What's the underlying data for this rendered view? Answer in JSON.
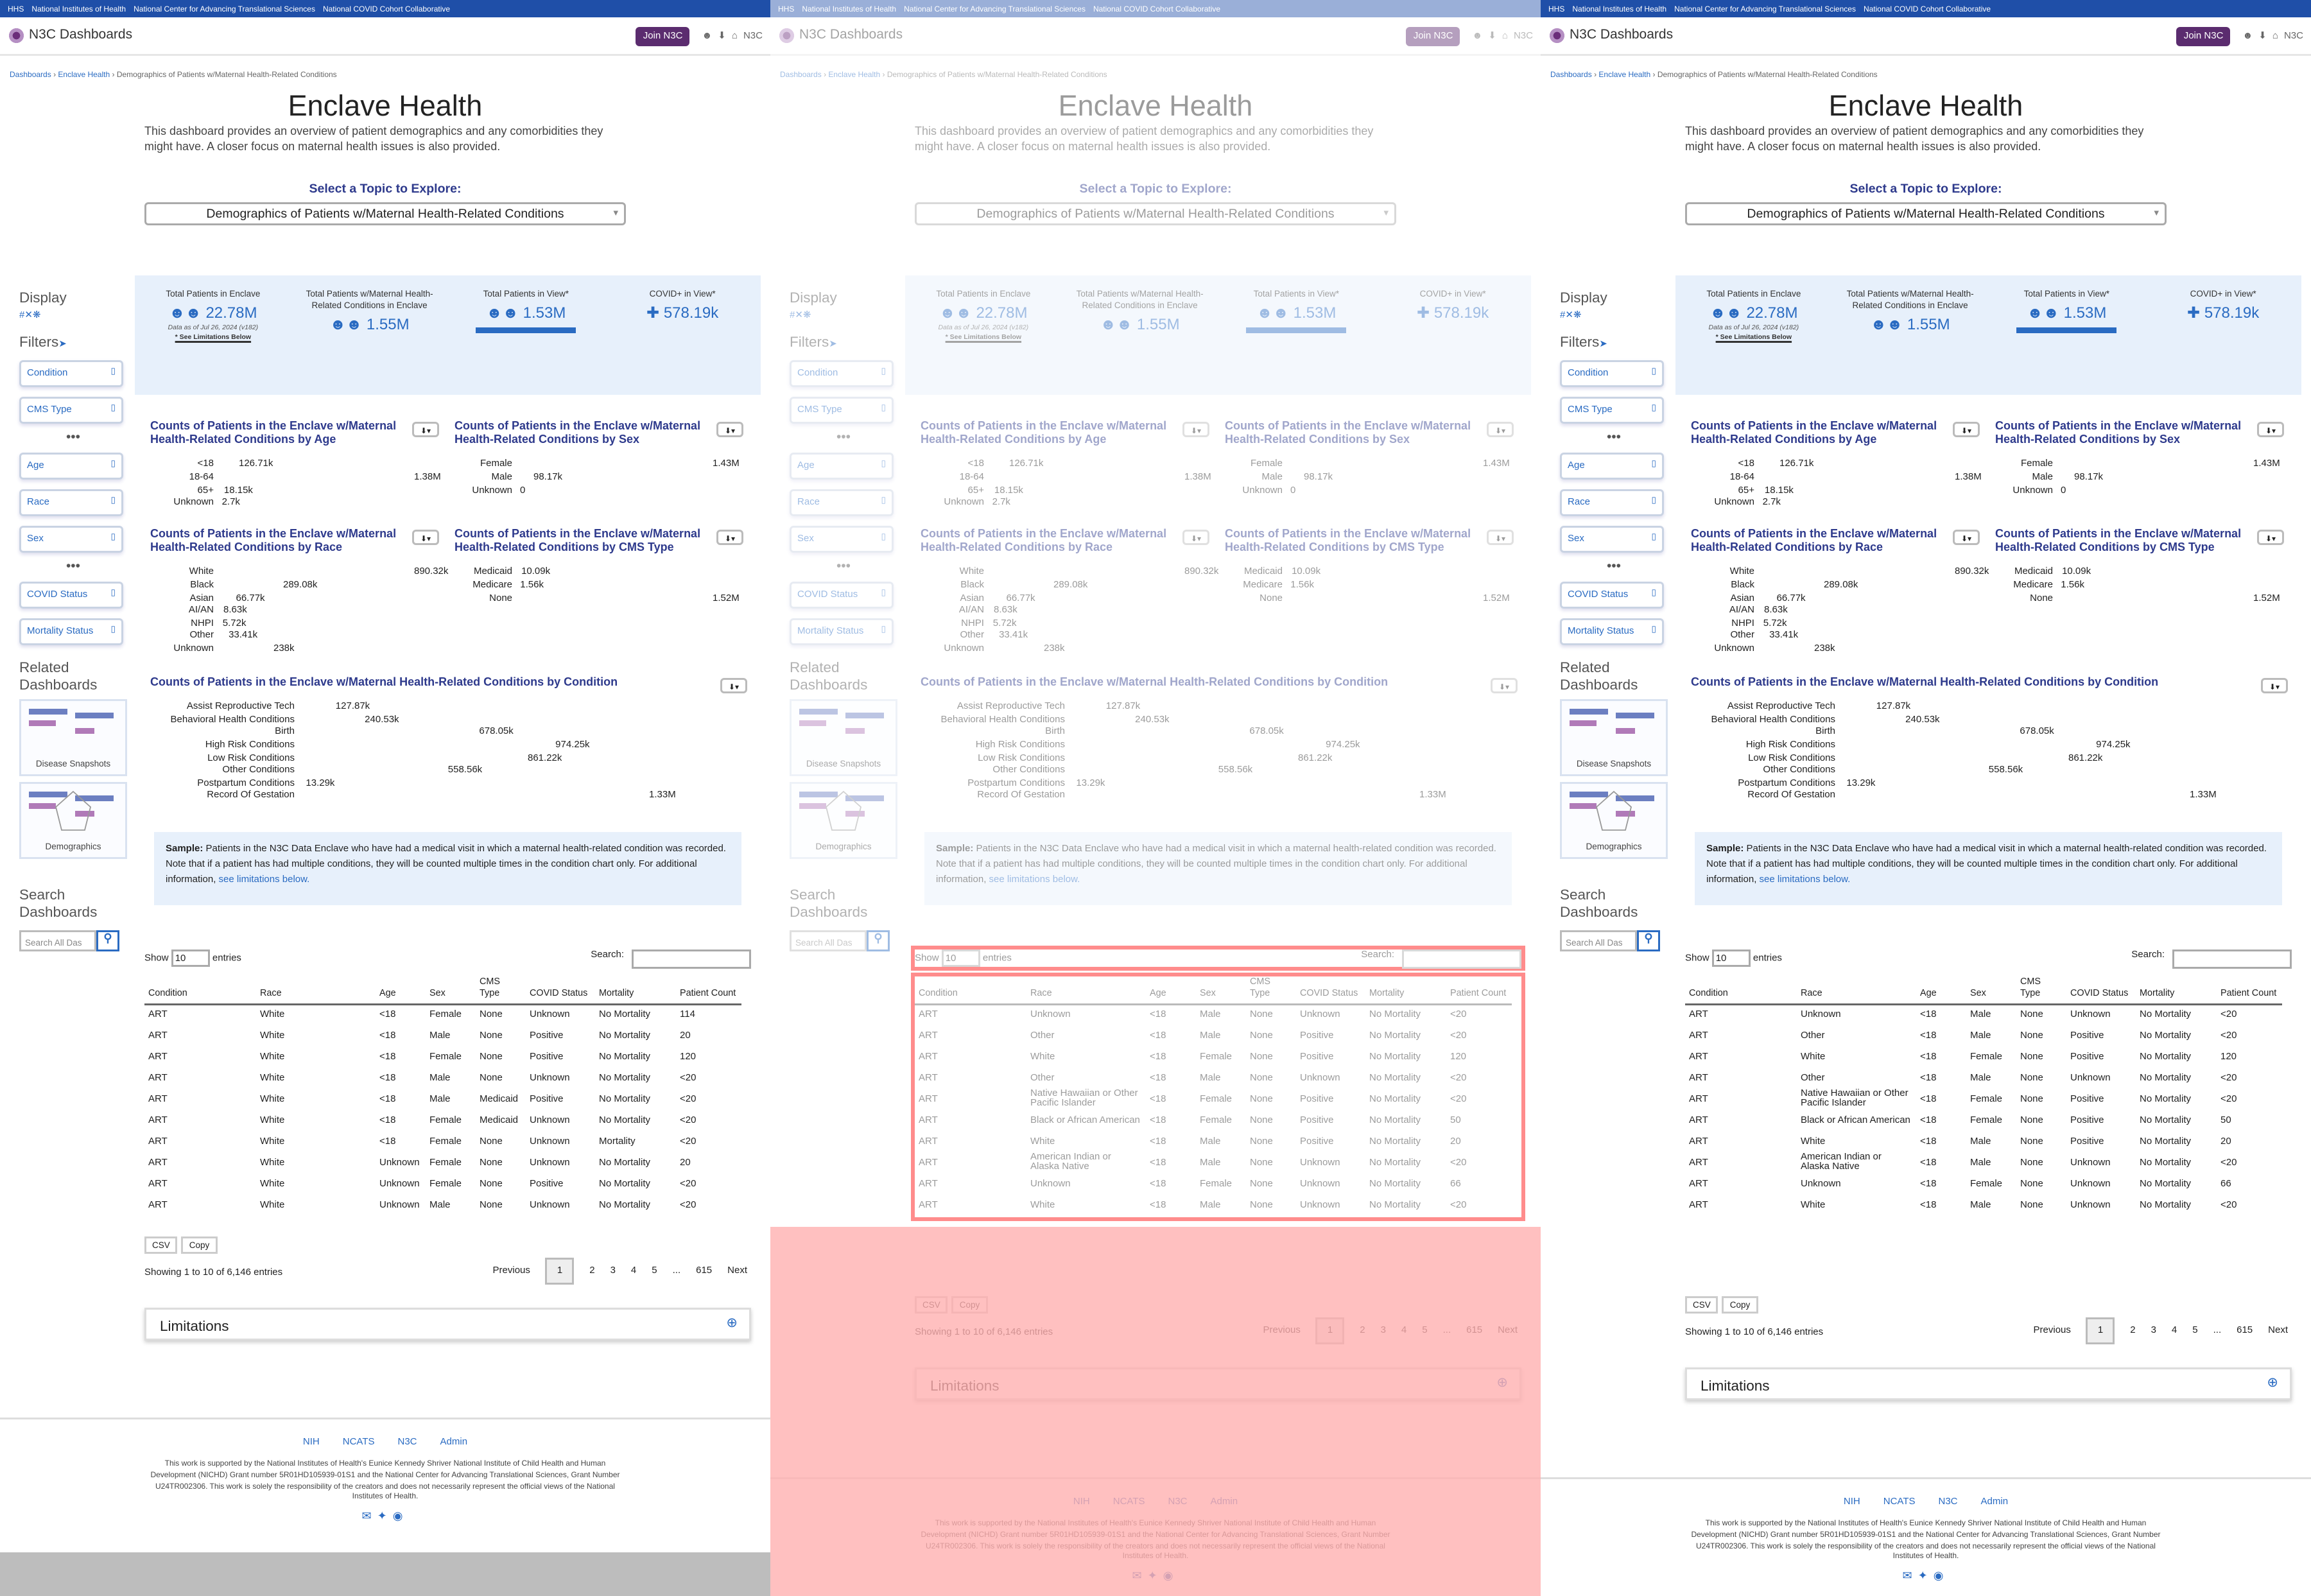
{
  "topbar": [
    "HHS",
    "National Institutes of Health",
    "National Center for Advancing Translational Sciences",
    "National COVID Cohort Collaborative"
  ],
  "header": {
    "brand": "N3C Dashboards",
    "join": "Join N3C",
    "n3c": "N3C"
  },
  "breadcrumb": {
    "home": "Dashboards",
    "section": "Enclave Health",
    "current": "Demographics of Patients w/Maternal Health-Related Conditions"
  },
  "page": {
    "title": "Enclave Health",
    "intro": "This dashboard provides an overview of patient demographics and any comorbidities they might have. A closer focus on maternal health issues is also provided.",
    "select_label": "Select a Topic to Explore:",
    "select_value": "Demographics of Patients w/Maternal Health-Related Conditions"
  },
  "sidebar": {
    "display": "Display",
    "filters": "Filters",
    "filter_items": [
      "Condition",
      "CMS Type",
      "Age",
      "Race",
      "Sex",
      "COVID Status",
      "Mortality Status"
    ],
    "related": "Related Dashboards",
    "related_items": [
      "Disease Snapshots",
      "Demographics"
    ],
    "search_title": "Search Dashboards",
    "search_placeholder": "Search All Das"
  },
  "stats": {
    "total": {
      "label": "Total Patients in Enclave",
      "value": "22.78M",
      "note": "Data as of Jul 26, 2024 (v182)",
      "lim": "* See Limitations Below"
    },
    "maternal": {
      "label": "Total Patients w/Maternal Health-Related Conditions in Enclave",
      "value": "1.55M"
    },
    "view": {
      "label": "Total Patients in View*",
      "value": "1.53M"
    },
    "covid": {
      "label": "COVID+ in View*",
      "value": "578.19k"
    }
  },
  "charts": {
    "age": {
      "title": "Counts of Patients in the Enclave w/Maternal Health-Related Conditions by Age",
      "rows": [
        [
          "<18",
          "126.71k",
          0.09
        ],
        [
          "18-64",
          "1.38M",
          1.0
        ],
        [
          "65+",
          "18.15k",
          0.013
        ],
        [
          "Unknown",
          "2.7k",
          0.002
        ]
      ]
    },
    "sex": {
      "title": "Counts of Patients in the Enclave w/Maternal Health-Related Conditions by Sex",
      "rows": [
        [
          "Female",
          "1.43M",
          1.0
        ],
        [
          "Male",
          "98.17k",
          0.07
        ],
        [
          "Unknown",
          "0",
          0
        ]
      ]
    },
    "race": {
      "title": "Counts of Patients in the Enclave w/Maternal Health-Related Conditions by Race",
      "rows": [
        [
          "White",
          "890.32k",
          1.0
        ],
        [
          "Black",
          "289.08k",
          0.32
        ],
        [
          "Asian",
          "66.77k",
          0.075
        ],
        [
          "AI/AN",
          "8.63k",
          0.01
        ],
        [
          "NHPI",
          "5.72k",
          0.006
        ],
        [
          "Other",
          "33.41k",
          0.037
        ],
        [
          "Unknown",
          "238k",
          0.27
        ]
      ]
    },
    "cms": {
      "title": "Counts of Patients in the Enclave w/Maternal Health-Related Conditions by CMS Type",
      "rows": [
        [
          "Medicaid",
          "10.09k",
          0.007
        ],
        [
          "Medicare",
          "1.56k",
          0.001
        ],
        [
          "None",
          "1.52M",
          1.0
        ]
      ]
    },
    "cond": {
      "title": "Counts of Patients in the Enclave w/Maternal Health-Related Conditions by Condition",
      "rows": [
        [
          "Assist Reproductive Tech",
          "127.87k",
          0.096
        ],
        [
          "Behavioral Health Conditions",
          "240.53k",
          0.18
        ],
        [
          "Birth",
          "678.05k",
          0.51
        ],
        [
          "High Risk Conditions",
          "974.25k",
          0.73
        ],
        [
          "Low Risk Conditions",
          "861.22k",
          0.65
        ],
        [
          "Other Conditions",
          "558.56k",
          0.42
        ],
        [
          "Postpartum Conditions",
          "13.29k",
          0.01
        ],
        [
          "Record Of Gestation",
          "1.33M",
          1.0
        ]
      ]
    }
  },
  "sample": {
    "bold": "Sample:",
    "text": "Patients in the N3C Data Enclave who have had a medical visit in which a maternal health-related condition was recorded. Note that if a patient has had multiple conditions, they will be counted multiple times in the condition chart only. For additional information,",
    "link": "see limitations below."
  },
  "table": {
    "show": "Show",
    "entries": "entries",
    "length": "10",
    "search": "Search:",
    "headers": [
      "Condition",
      "Race",
      "Age",
      "Sex",
      "CMS Type",
      "COVID Status",
      "Mortality",
      "Patient Count"
    ],
    "rows1": [
      [
        "ART",
        "White",
        "<18",
        "Female",
        "None",
        "Unknown",
        "No Mortality",
        "114"
      ],
      [
        "ART",
        "White",
        "<18",
        "Male",
        "None",
        "Positive",
        "No Mortality",
        "20"
      ],
      [
        "ART",
        "White",
        "<18",
        "Female",
        "None",
        "Positive",
        "No Mortality",
        "120"
      ],
      [
        "ART",
        "White",
        "<18",
        "Male",
        "None",
        "Unknown",
        "No Mortality",
        "<20"
      ],
      [
        "ART",
        "White",
        "<18",
        "Male",
        "Medicaid",
        "Positive",
        "No Mortality",
        "<20"
      ],
      [
        "ART",
        "White",
        "<18",
        "Female",
        "Medicaid",
        "Unknown",
        "No Mortality",
        "<20"
      ],
      [
        "ART",
        "White",
        "<18",
        "Female",
        "None",
        "Unknown",
        "Mortality",
        "<20"
      ],
      [
        "ART",
        "White",
        "Unknown",
        "Female",
        "None",
        "Unknown",
        "No Mortality",
        "20"
      ],
      [
        "ART",
        "White",
        "Unknown",
        "Female",
        "None",
        "Positive",
        "No Mortality",
        "<20"
      ],
      [
        "ART",
        "White",
        "Unknown",
        "Male",
        "None",
        "Unknown",
        "No Mortality",
        "<20"
      ]
    ],
    "rows3": [
      [
        "ART",
        "Unknown",
        "<18",
        "Male",
        "None",
        "Unknown",
        "No Mortality",
        "<20"
      ],
      [
        "ART",
        "Other",
        "<18",
        "Male",
        "None",
        "Positive",
        "No Mortality",
        "<20"
      ],
      [
        "ART",
        "White",
        "<18",
        "Female",
        "None",
        "Positive",
        "No Mortality",
        "120"
      ],
      [
        "ART",
        "Other",
        "<18",
        "Male",
        "None",
        "Unknown",
        "No Mortality",
        "<20"
      ],
      [
        "ART",
        "Native Hawaiian or Other Pacific Islander",
        "<18",
        "Female",
        "None",
        "Positive",
        "No Mortality",
        "<20"
      ],
      [
        "ART",
        "Black or African American",
        "<18",
        "Female",
        "None",
        "Positive",
        "No Mortality",
        "50"
      ],
      [
        "ART",
        "White",
        "<18",
        "Male",
        "None",
        "Positive",
        "No Mortality",
        "20"
      ],
      [
        "ART",
        "American Indian or Alaska Native",
        "<18",
        "Male",
        "None",
        "Unknown",
        "No Mortality",
        "<20"
      ],
      [
        "ART",
        "Unknown",
        "<18",
        "Female",
        "None",
        "Unknown",
        "No Mortality",
        "66"
      ],
      [
        "ART",
        "White",
        "<18",
        "Male",
        "None",
        "Unknown",
        "No Mortality",
        "<20"
      ]
    ],
    "csv": "CSV",
    "copy": "Copy",
    "info": "Showing 1 to 10 of 6,146 entries",
    "prev": "Previous",
    "pages": [
      "1",
      "2",
      "3",
      "4",
      "5",
      "...",
      "615"
    ],
    "next": "Next"
  },
  "limitations": "Limitations",
  "footer": {
    "links": [
      "NIH",
      "NCATS",
      "N3C",
      "Admin"
    ],
    "text": "This work is supported by the National Institutes of Health's Eunice Kennedy Shriver National Institute of Child Health and Human Development (NICHD) Grant number 5R01HD105939-01S1 and the National Center for Advancing Translational Sciences, Grant Number U24TR002306. This work is solely the responsibility of the creators and does not necessarily represent the official views of the National Institutes of Health."
  },
  "colors": {
    "primary": "#2a6bc2",
    "topbar": "#1f4fa8",
    "join": "#5b2c6f",
    "statsBg": "#e7f0fb",
    "overlay": "#ff0000"
  }
}
